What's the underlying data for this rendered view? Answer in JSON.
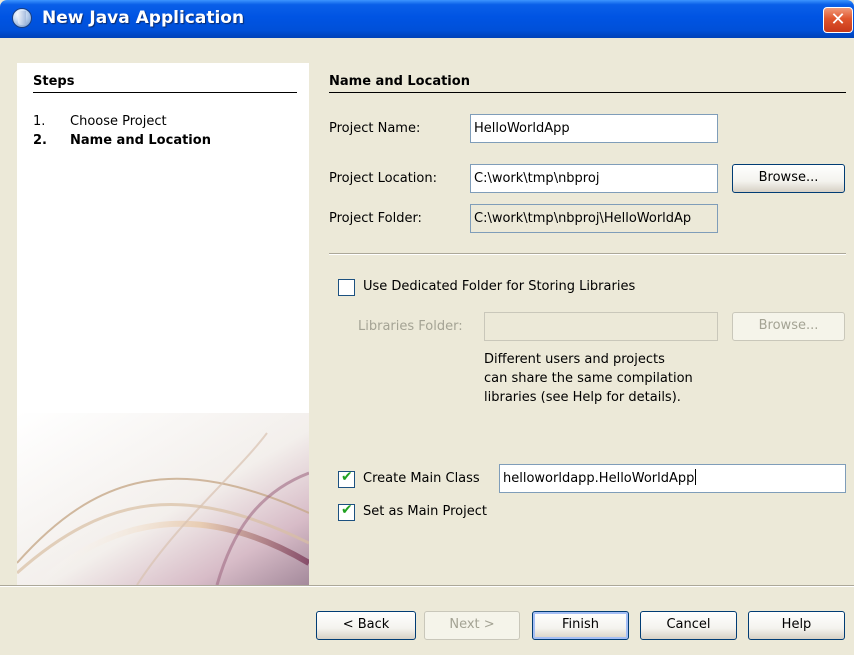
{
  "window": {
    "title": "New Java Application",
    "close_glyph": "✕"
  },
  "steps": {
    "heading": "Steps",
    "items": [
      {
        "num": "1.",
        "label": "Choose Project"
      },
      {
        "num": "2.",
        "label": "Name and Location"
      }
    ]
  },
  "panel": {
    "heading": "Name and Location",
    "project_name_label": "Project Name:",
    "project_name_value": "HelloWorldApp",
    "project_location_label": "Project Location:",
    "project_location_value": "C:\\work\\tmp\\nbproj",
    "browse_label": "Browse...",
    "project_folder_label": "Project Folder:",
    "project_folder_value": "C:\\work\\tmp\\nbproj\\HelloWorldAp",
    "dedicated_folder_label": "Use Dedicated Folder for Storing Libraries",
    "dedicated_folder_checked": false,
    "libraries_folder_label": "Libraries Folder:",
    "libraries_folder_value": "",
    "libraries_browse_label": "Browse...",
    "description_lines": [
      "Different users and projects",
      "can share the same compilation",
      "libraries (see Help for details)."
    ],
    "create_main_class_label": "Create Main Class",
    "create_main_class_checked": true,
    "main_class_value": "helloworldapp.HelloWorldApp",
    "set_main_project_label": "Set as Main Project",
    "set_main_project_checked": true,
    "check_glyph": "✔"
  },
  "buttons": {
    "back": "< Back",
    "next": "Next >",
    "finish": "Finish",
    "cancel": "Cancel",
    "help": "Help"
  }
}
